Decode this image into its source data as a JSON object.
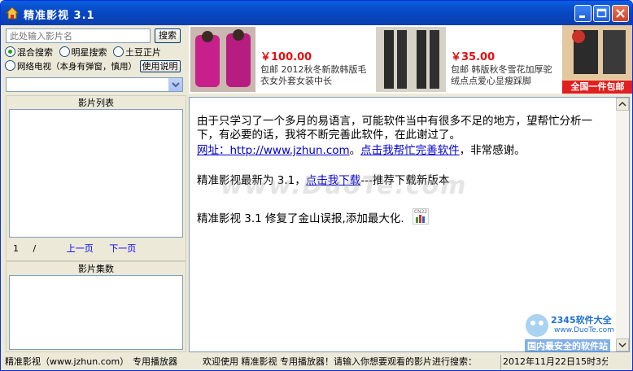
{
  "window": {
    "title": "精准影视  3.1"
  },
  "search": {
    "placeholder": "此处输入影片名",
    "button": "搜索"
  },
  "radios": {
    "mixed": "混合搜索",
    "star": "明星搜索",
    "tudou": "土豆正片",
    "nettv": "网络电视（本身有弹窗，慎用）",
    "help_button": "使用说明"
  },
  "movie_list": {
    "title": "影片列表",
    "page_current": "1",
    "page_sep": "/",
    "prev": "上一页",
    "next": "下一页"
  },
  "episodes": {
    "title": "影片集数"
  },
  "ads": [
    {
      "price": "￥100.00",
      "text": "包邮  2012秋冬新款韩版毛衣女外套女装中长"
    },
    {
      "price": "￥35.00",
      "text": "包邮  韩版秋冬雪花加厚驼绒点点爱心显瘦踩脚"
    },
    {
      "text": "全国一件包邮"
    }
  ],
  "content": {
    "line1": "由于只学习了一个多月的易语言，可能软件当中有很多不足的地方，望帮忙分析一下，有必要的话，我将不断完善此软件，在此谢过了。",
    "url_label": "网址：http://www.jzhun.com",
    "url_sep": "。",
    "help_link": "点击我帮忙完善软件",
    "url_tail": "，非常感谢。",
    "latest_prefix": "精准影视最新为 3.1，",
    "download_link": "点击我下载",
    "latest_suffix": "---推荐下载新版本",
    "fix_note": "精准影视 3.1 修复了金山误报,添加最大化.",
    "chart_badge": "CN22"
  },
  "watermark": "www.DuoTe.com",
  "statusbar": {
    "left": "精准影视（www.jzhun.com）",
    "player": "专用播放器",
    "message": "欢迎使用 精准影视 专用播放器！请输入你想要观看的影片进行搜索：",
    "time": "2012年11月22日15时3分"
  },
  "corner_logo": {
    "brand": "2345软件大全",
    "url": "www.DuoTe.com",
    "slogan": "国内最安全的软件站"
  },
  "colors": {
    "title_bar": "#0A5FE0",
    "link": "#0000CC",
    "price": "#E01010"
  }
}
